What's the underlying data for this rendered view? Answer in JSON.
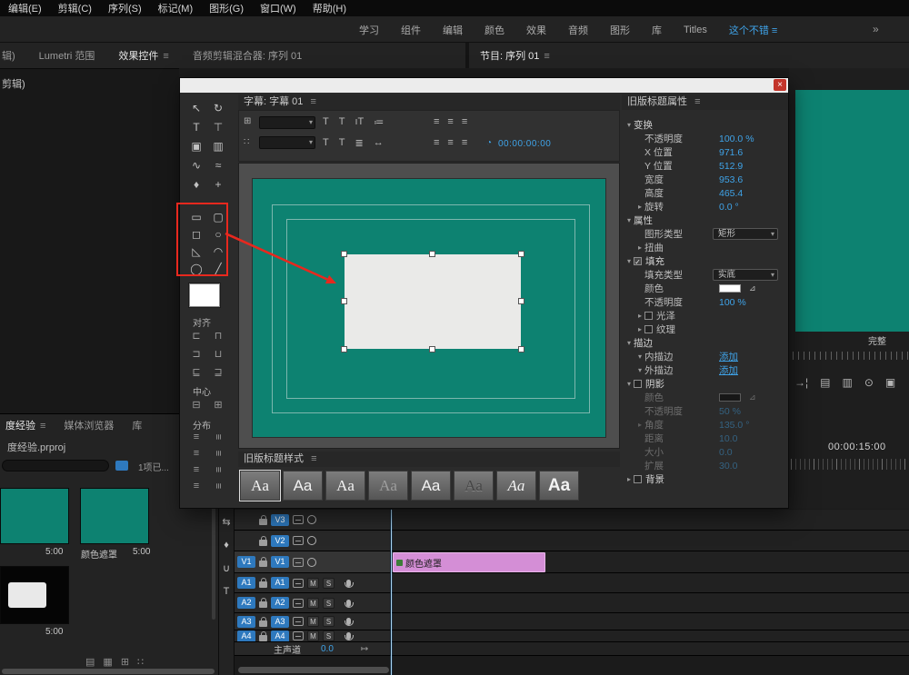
{
  "colors": {
    "accent_blue": "#3fa3e8",
    "teal": "#0d8271",
    "clip_pink": "#d48ed6",
    "annotation_red": "#e8281e"
  },
  "menu": {
    "items": [
      "编辑(E)",
      "剪辑(C)",
      "序列(S)",
      "标记(M)",
      "图形(G)",
      "窗口(W)",
      "帮助(H)"
    ]
  },
  "workspace": {
    "tabs": [
      "学习",
      "组件",
      "编辑",
      "颜色",
      "效果",
      "音频",
      "图形",
      "库",
      "Titles"
    ],
    "active_tab": "这个不错",
    "menu_icon": "≡",
    "overflow_icon": "»"
  },
  "panel_tabs": {
    "fragment": "辑)",
    "lumetri": "Lumetri 范围",
    "effect_controls": "效果控件",
    "menu_icon": "≡",
    "audio_mixer": "音频剪辑混合器: 序列 01",
    "program": "节目: 序列 01"
  },
  "effects_panel": {
    "fragment": "剪辑)"
  },
  "program": {
    "fit_label": "完整",
    "transport_icons": [
      {
        "name": "goto-out-icon",
        "glyph": "→¦"
      },
      {
        "name": "lift-icon",
        "glyph": "▤"
      },
      {
        "name": "extract-icon",
        "glyph": "▥"
      },
      {
        "name": "export-frame-icon",
        "glyph": "⊙"
      },
      {
        "name": "comparison-view-icon",
        "glyph": "▣"
      }
    ]
  },
  "titler": {
    "tab": "字幕: 字幕 01",
    "menu_icon": "≡",
    "dialog_close": "×",
    "controls": {
      "grid_icon": "⊞",
      "dots_icon": "∷",
      "font_dropdown_value": "",
      "style_dropdown_value": "",
      "dropdown_caret": "▾",
      "icons_row1": [
        {
          "name": "bold-icon",
          "glyph": "T"
        },
        {
          "name": "italic-icon",
          "glyph": "T"
        },
        {
          "name": "font-size-icon",
          "glyph": "ıT"
        },
        {
          "name": "kerning-icon",
          "glyph": "≔"
        }
      ],
      "icons_row2": [
        {
          "name": "underline-icon",
          "glyph": "T"
        },
        {
          "name": "slant-icon",
          "glyph": "T"
        },
        {
          "name": "leading-icon",
          "glyph": "≣"
        },
        {
          "name": "tracking-icon",
          "glyph": "↔"
        }
      ],
      "align_icons_row1": [
        {
          "name": "align-left-icon",
          "glyph": "≡"
        },
        {
          "name": "align-center-icon",
          "glyph": "≡"
        },
        {
          "name": "align-right-icon",
          "glyph": "≡"
        }
      ],
      "align_icons_row2": [
        {
          "name": "tab-stops-icon",
          "glyph": "≡"
        },
        {
          "name": "wrap-text-icon",
          "glyph": "≡"
        },
        {
          "name": "show-background-icon",
          "glyph": "≡"
        }
      ],
      "stopwatch_icon": "◔",
      "timecode": "00:00:00:00"
    },
    "tools": [
      {
        "name": "selection-tool-icon",
        "glyph": "↖"
      },
      {
        "name": "rotation-tool-icon",
        "glyph": "↻"
      },
      {
        "name": "type-tool-icon",
        "glyph": "T"
      },
      {
        "name": "vertical-type-tool-icon",
        "glyph": "⊤"
      },
      {
        "name": "area-type-tool-icon",
        "glyph": "▣"
      },
      {
        "name": "vertical-area-type-tool-icon",
        "glyph": "▥"
      },
      {
        "name": "path-type-tool-icon",
        "glyph": "∿"
      },
      {
        "name": "vertical-path-type-tool-icon",
        "glyph": "≈"
      },
      {
        "name": "pen-tool-icon",
        "glyph": "♦"
      },
      {
        "name": "add-anchor-point-tool-icon",
        "glyph": "+"
      }
    ],
    "shape_tools": [
      {
        "name": "rectangle-tool-icon",
        "glyph": "▭"
      },
      {
        "name": "rounded-rectangle-tool-icon",
        "glyph": "▢"
      },
      {
        "name": "clipped-corner-rectangle-tool-icon",
        "glyph": "◻"
      },
      {
        "name": "round-corner-rectangle-tool-icon",
        "glyph": "○"
      },
      {
        "name": "wedge-tool-icon",
        "glyph": "◺"
      },
      {
        "name": "arc-tool-icon",
        "glyph": "◠"
      },
      {
        "name": "ellipse-tool-icon",
        "glyph": "◯"
      },
      {
        "name": "line-tool-icon",
        "glyph": "╱"
      }
    ],
    "align": {
      "title": "对齐",
      "icons": [
        {
          "name": "align-horizontal-left-icon",
          "glyph": "⊏"
        },
        {
          "name": "align-vertical-top-icon",
          "glyph": "⊓"
        },
        {
          "name": "align-horizontal-center-icon",
          "glyph": "⊐"
        },
        {
          "name": "align-vertical-center-icon",
          "glyph": "⊔"
        },
        {
          "name": "align-horizontal-right-icon",
          "glyph": "⊑"
        },
        {
          "name": "align-vertical-bottom-icon",
          "glyph": "⊒"
        }
      ]
    },
    "center": {
      "title": "中心",
      "icons": [
        {
          "name": "center-horizontal-icon",
          "glyph": "⊟"
        },
        {
          "name": "center-vertical-icon",
          "glyph": "⊞"
        }
      ]
    },
    "distribute": {
      "title": "分布",
      "icons": [
        {
          "name": "distribute-horizontal-left-icon",
          "glyph": "≡"
        },
        {
          "name": "distribute-vertical-top-icon",
          "glyph": "≡"
        },
        {
          "name": "distribute-horizontal-center-icon",
          "glyph": "≡"
        },
        {
          "name": "distribute-vertical-center-icon",
          "glyph": "≡"
        },
        {
          "name": "distribute-horizontal-right-icon",
          "glyph": "≡"
        },
        {
          "name": "distribute-vertical-bottom-icon",
          "glyph": "≡"
        },
        {
          "name": "distribute-horizontal-even-icon",
          "glyph": "≡"
        },
        {
          "name": "distribute-vertical-even-icon",
          "glyph": "≡"
        }
      ]
    },
    "styles_title": "旧版标题样式",
    "styles": [
      "Aa",
      "Aa",
      "Aa",
      "Aa",
      "Aa",
      "Aa",
      "Aa",
      "Aa"
    ],
    "properties": {
      "title": "旧版标题属性",
      "rows": [
        {
          "a": "▾",
          "label": "变换",
          "group": true
        },
        {
          "label": "不透明度",
          "value": "100.0 %",
          "ind": true
        },
        {
          "label": "X 位置",
          "value": "971.6",
          "ind": true
        },
        {
          "label": "Y 位置",
          "value": "512.9",
          "ind": true
        },
        {
          "label": "宽度",
          "value": "953.6",
          "ind": true
        },
        {
          "label": "高度",
          "value": "465.4",
          "ind": true
        },
        {
          "a": "▸",
          "label": "旋转",
          "value": "0.0 °",
          "ind": true
        },
        {
          "a": "▾",
          "label": "属性",
          "group": true
        },
        {
          "label": "图形类型",
          "value": "矩形",
          "dd": true,
          "ind": true
        },
        {
          "a": "▸",
          "label": "扭曲",
          "ind": true
        },
        {
          "a": "▾",
          "cb": true,
          "label": "填充",
          "group": true
        },
        {
          "label": "填充类型",
          "value": "实底",
          "dd": true,
          "ind": true
        },
        {
          "label": "颜色",
          "swatch": "#ffffff",
          "ind": true
        },
        {
          "label": "不透明度",
          "value": "100 %",
          "ind": true
        },
        {
          "a": "▸",
          "cb": false,
          "label": "光泽",
          "ind": true
        },
        {
          "a": "▸",
          "cb": false,
          "label": "纹理",
          "ind": true
        },
        {
          "a": "▾",
          "label": "描边",
          "group": true
        },
        {
          "a": "▾",
          "label": "内描边",
          "link": "添加",
          "ind": true
        },
        {
          "a": "▾",
          "label": "外描边",
          "link": "添加",
          "ind": true
        },
        {
          "a": "▾",
          "cb": false,
          "label": "阴影",
          "group": true
        },
        {
          "label": "颜色",
          "swatch": "#000000",
          "ind": true,
          "dim": true
        },
        {
          "label": "不透明度",
          "value": "50 %",
          "ind": true,
          "dim": true
        },
        {
          "a": "▸",
          "label": "角度",
          "value": "135.0 °",
          "ind": true,
          "dim": true
        },
        {
          "label": "距离",
          "value": "10.0",
          "ind": true,
          "dim": true
        },
        {
          "label": "大小",
          "value": "0.0",
          "ind": true,
          "dim": true
        },
        {
          "label": "扩展",
          "value": "30.0",
          "ind": true,
          "dim": true
        },
        {
          "a": "▸",
          "cb": false,
          "label": "背景",
          "group": true
        }
      ]
    }
  },
  "project": {
    "tabs": [
      {
        "label": "度经验"
      },
      {
        "label": "媒体浏览器"
      },
      {
        "label": "库"
      }
    ],
    "menu_icon": "≡",
    "filename": "度经验.prproj",
    "selection_info": "1项已...",
    "items": [
      {
        "name": "",
        "duration": "5:00"
      },
      {
        "name": "颜色遮罩",
        "duration": "5:00"
      },
      {
        "name": "",
        "duration": "5:00"
      }
    ],
    "bottom_icons": [
      {
        "name": "list-view-icon",
        "glyph": "▤"
      },
      {
        "name": "icon-view-icon",
        "glyph": "▦"
      },
      {
        "name": "freeform-view-icon",
        "glyph": "⊞"
      },
      {
        "name": "sort-icon",
        "glyph": "∷"
      }
    ]
  },
  "tools_strip": [
    {
      "name": "track-select-tool-icon",
      "glyph": "⇆"
    },
    {
      "name": "pen-tool-icon",
      "glyph": "♦"
    },
    {
      "name": "hand-tool-icon",
      "glyph": "∪"
    },
    {
      "name": "type-tool-icon",
      "glyph": "T"
    }
  ],
  "timeline": {
    "timecode": "00:00:15:00",
    "video_tracks": [
      {
        "name": "V3"
      },
      {
        "name": "V2"
      },
      {
        "name": "V1",
        "source": true,
        "selected": true
      }
    ],
    "audio_tracks": [
      {
        "name": "A1",
        "source": true
      },
      {
        "name": "A2",
        "source": true
      },
      {
        "name": "A3",
        "source": true
      },
      {
        "name": "A4",
        "source": true
      }
    ],
    "mute_label": "M",
    "solo_label": "S",
    "master_label": "主声道",
    "master_value": "0.0",
    "master_icon": "↦",
    "clip_label": "颜色遮罩"
  }
}
